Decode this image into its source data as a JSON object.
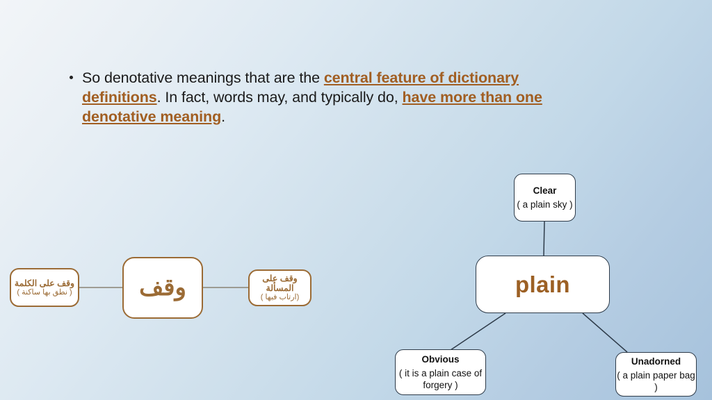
{
  "slide": {
    "background_top_left": "#f2f5f8",
    "background_bottom_right": "#a6c2dc",
    "accent_color": "#a15e22",
    "arabic_node_color": "#9b6b35",
    "english_border_color": "#2e3b49"
  },
  "bullet": {
    "marker": "bullet-dot",
    "segments": [
      {
        "text": "So denotative meanings that are the ",
        "highlight": false
      },
      {
        "text": "central feature of dictionary definitions",
        "highlight": true
      },
      {
        "text": ". In fact, words may, and typically do, ",
        "highlight": false
      },
      {
        "text": "have more than one denotative meaning",
        "highlight": true
      },
      {
        "text": ".",
        "highlight": false
      }
    ],
    "full_text": "So denotative meanings that are the central feature of dictionary definitions. In fact, words may, and typically do, have more than one denotative meaning."
  },
  "arabic_map": {
    "center": {
      "label": "وقف"
    },
    "left": {
      "title": "وقف على الكلمة",
      "sub": "( نطق بها ساكنة )"
    },
    "right": {
      "title": "وقف على المسألة",
      "sub": "(ارتاب فيها )"
    }
  },
  "plain_map": {
    "center": {
      "label": "plain"
    },
    "top": {
      "title": "Clear",
      "sub": "( a plain sky )"
    },
    "bottom_left": {
      "title": "Obvious",
      "sub": "( it is a plain case of forgery )"
    },
    "bottom_right": {
      "title": "Unadorned",
      "sub": "( a plain paper bag )"
    }
  }
}
